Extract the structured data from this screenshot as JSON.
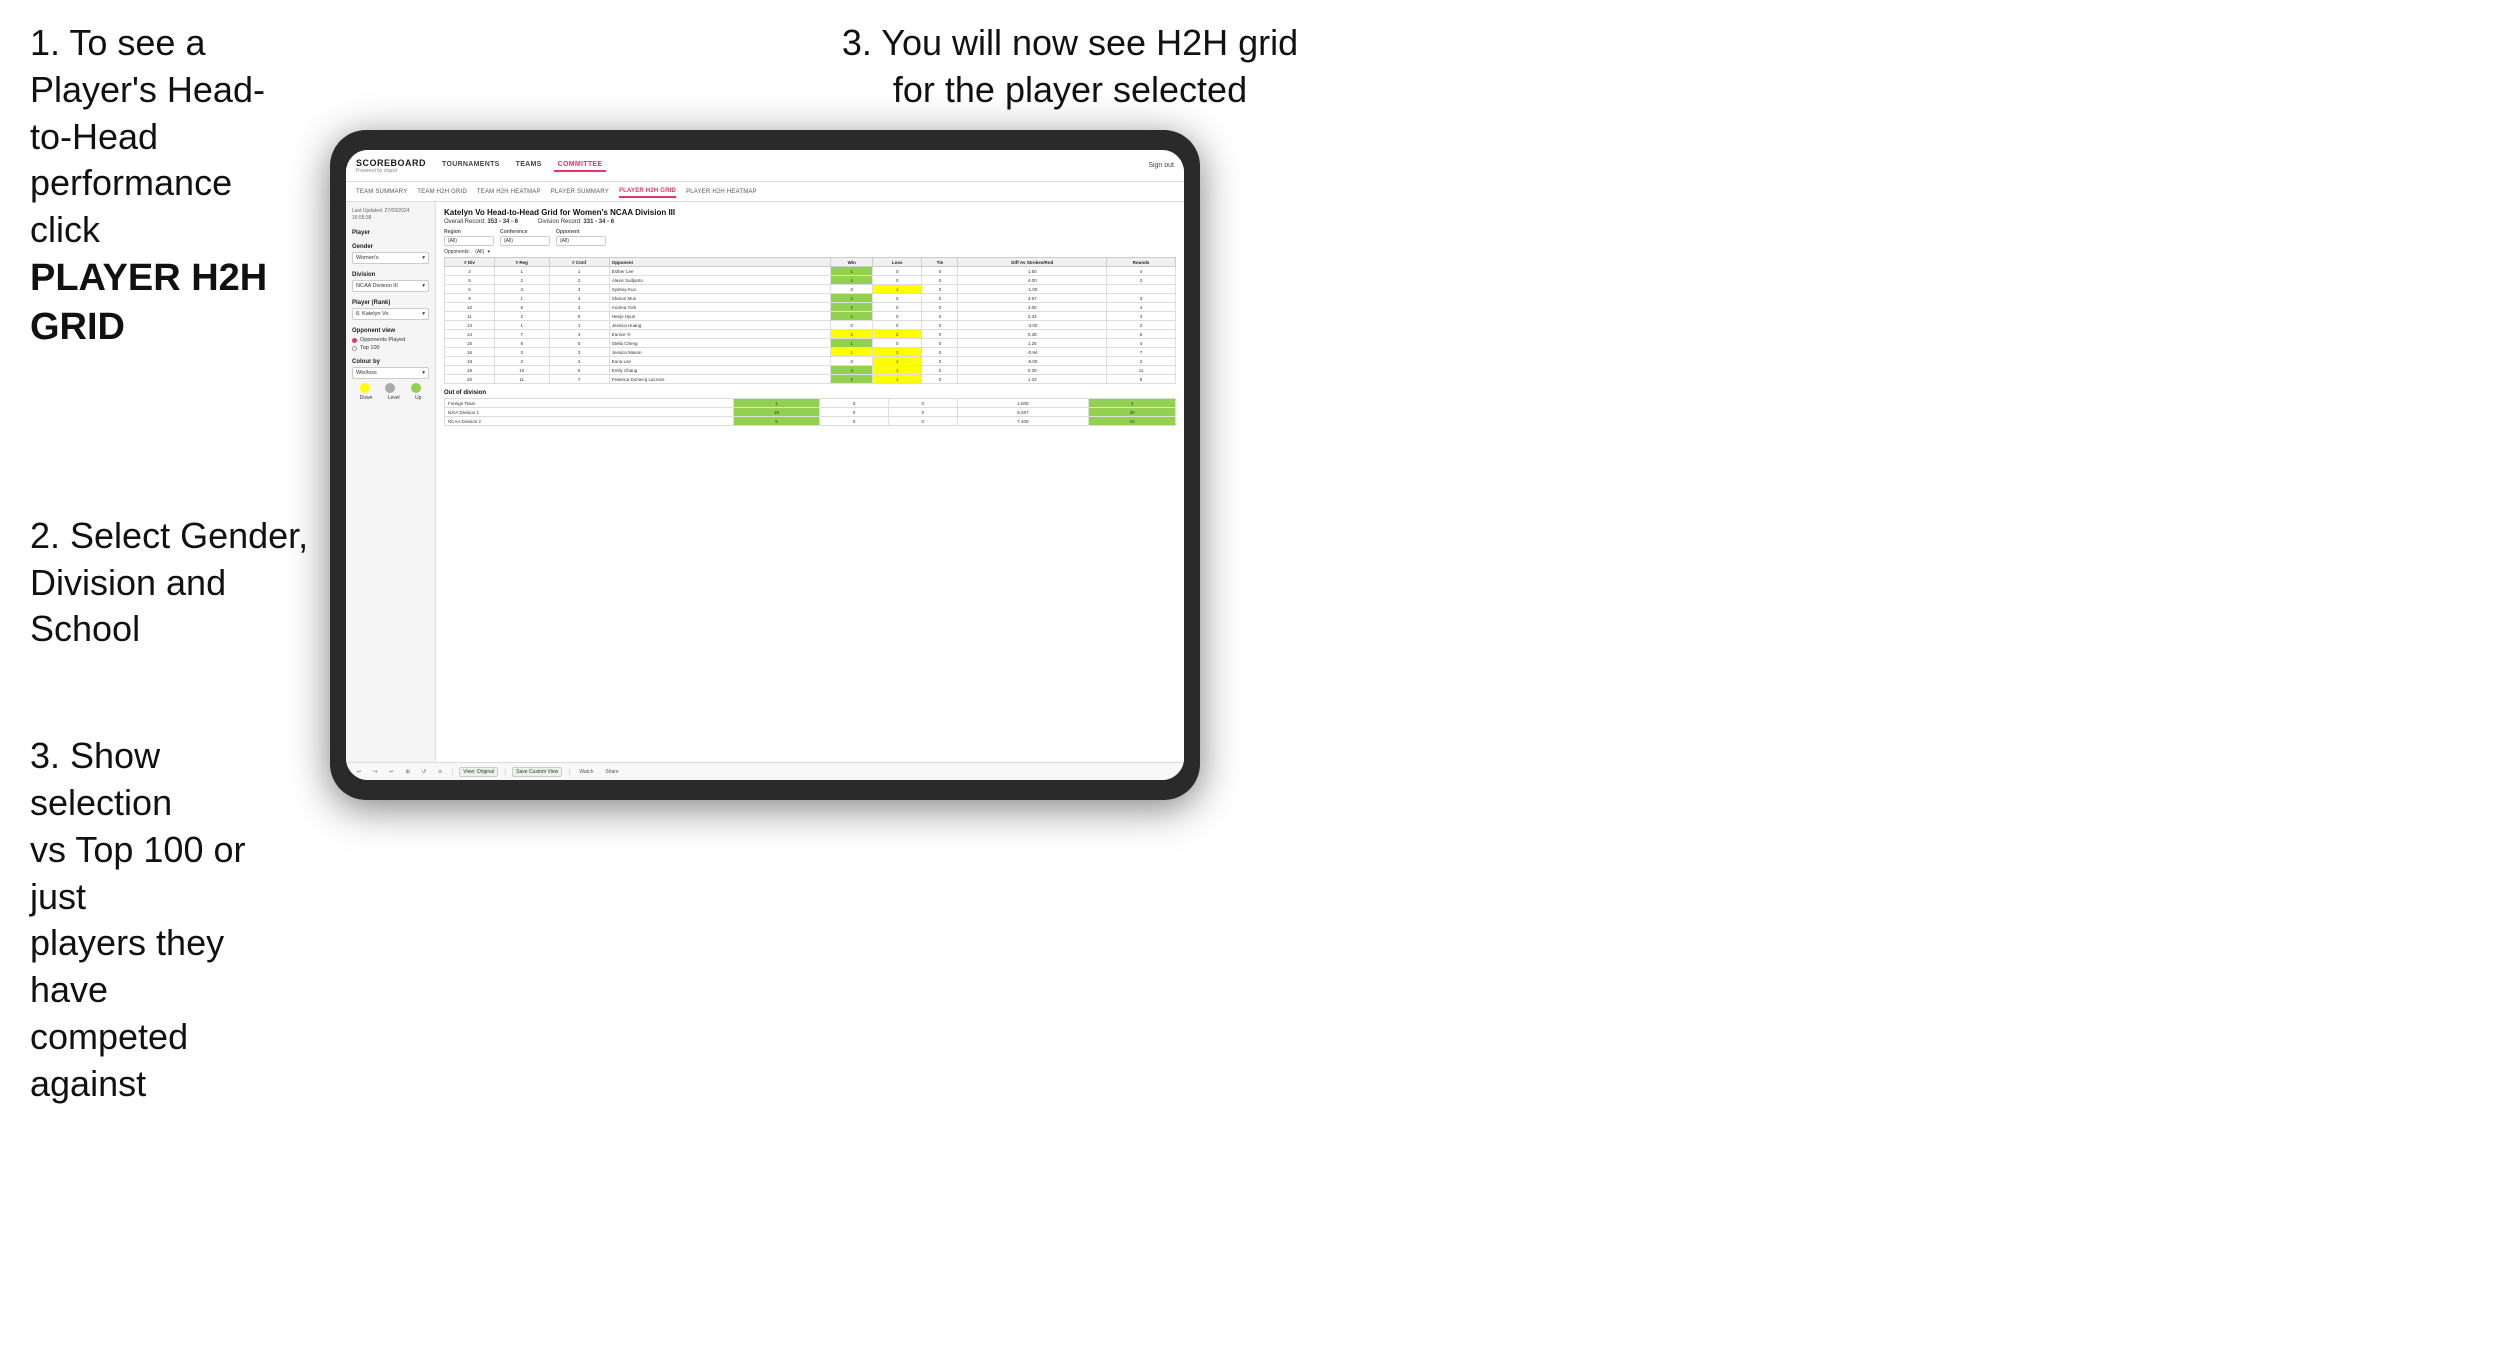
{
  "instructions": {
    "step1_line1": "1. To see a Player's Head-",
    "step1_line2": "to-Head performance click",
    "step1_bold": "PLAYER H2H GRID",
    "step2_line1": "2. Select Gender,",
    "step2_line2": "Division and",
    "step2_line3": "School",
    "step3a_line1": "3. You will now see H2H grid",
    "step3a_line2": "for the player selected",
    "step3b_line1": "3. Show selection",
    "step3b_line2": "vs Top 100 or just",
    "step3b_line3": "players they have",
    "step3b_line4": "competed against"
  },
  "navbar": {
    "logo": "SCOREBOARD",
    "logo_sub": "Powered by clippd",
    "nav_items": [
      "TOURNAMENTS",
      "TEAMS",
      "COMMITTEE"
    ],
    "sign_out": "Sign out"
  },
  "sub_navbar": {
    "items": [
      "TEAM SUMMARY",
      "TEAM H2H GRID",
      "TEAM H2H HEATMAP",
      "PLAYER SUMMARY",
      "PLAYER H2H GRID",
      "PLAYER H2H HEATMAP"
    ]
  },
  "sidebar": {
    "last_updated_label": "Last Updated: 27/03/2024",
    "last_updated_time": "16:55:38",
    "player_label": "Player",
    "gender_label": "Gender",
    "gender_value": "Women's",
    "division_label": "Division",
    "division_value": "NCAA Division III",
    "player_rank_label": "Player (Rank)",
    "player_rank_value": "8. Katelyn Vo",
    "opponent_view_label": "Opponent view",
    "radio1": "Opponents Played",
    "radio2": "Top 100",
    "colour_by_label": "Colour by",
    "colour_by_value": "Win/loss",
    "legend_down": "Down",
    "legend_level": "Level",
    "legend_up": "Up"
  },
  "grid": {
    "title": "Katelyn Vo Head-to-Head Grid for Women's NCAA Division III",
    "overall_record_label": "Overall Record:",
    "overall_record_value": "353 - 34 - 6",
    "division_record_label": "Division Record:",
    "division_record_value": "331 - 34 - 6",
    "region_label": "Region",
    "conference_label": "Conference",
    "opponent_label": "Opponent",
    "opponents_label": "Opponents:",
    "filter_all": "(All)",
    "col_div": "# Div",
    "col_reg": "# Reg",
    "col_conf": "# Conf",
    "col_opponent": "Opponent",
    "col_win": "Win",
    "col_loss": "Loss",
    "col_tie": "Tie",
    "col_diff": "Diff Av Strokes/Rnd",
    "col_rounds": "Rounds",
    "rows": [
      {
        "div": 3,
        "reg": 1,
        "conf": 1,
        "opponent": "Esther Lee",
        "win": 1,
        "loss": 0,
        "tie": 0,
        "diff": 1.5,
        "rounds": 4,
        "win_color": "green",
        "loss_color": "white",
        "tie_color": "white"
      },
      {
        "div": 5,
        "reg": 2,
        "conf": 2,
        "opponent": "Alexis Sudjanto",
        "win": 1,
        "loss": 0,
        "tie": 0,
        "diff": 4.0,
        "rounds": 3,
        "win_color": "green",
        "loss_color": "white",
        "tie_color": "white"
      },
      {
        "div": 6,
        "reg": 3,
        "conf": 3,
        "opponent": "Sydney Kuo",
        "win": 0,
        "loss": 1,
        "tie": 0,
        "diff": -1.0,
        "rounds": "",
        "win_color": "white",
        "loss_color": "yellow",
        "tie_color": "white"
      },
      {
        "div": 9,
        "reg": 1,
        "conf": 4,
        "opponent": "Sharon Mun",
        "win": 1,
        "loss": 0,
        "tie": 0,
        "diff": 3.67,
        "rounds": 3,
        "win_color": "green",
        "loss_color": "white",
        "tie_color": "white"
      },
      {
        "div": 10,
        "reg": 6,
        "conf": 3,
        "opponent": "Andrea York",
        "win": 2,
        "loss": 0,
        "tie": 0,
        "diff": 4.0,
        "rounds": 4,
        "win_color": "green",
        "loss_color": "white",
        "tie_color": "white"
      },
      {
        "div": 11,
        "reg": 2,
        "conf": 5,
        "opponent": "Heejo Hyun",
        "win": 1,
        "loss": 0,
        "tie": 0,
        "diff": 3.33,
        "rounds": 3,
        "win_color": "green",
        "loss_color": "white",
        "tie_color": "white"
      },
      {
        "div": 13,
        "reg": 1,
        "conf": 1,
        "opponent": "Jessica Huang",
        "win": 0,
        "loss": 0,
        "tie": 0,
        "diff": -3.0,
        "rounds": 2,
        "win_color": "white",
        "loss_color": "white",
        "tie_color": "white"
      },
      {
        "div": 14,
        "reg": 7,
        "conf": 4,
        "opponent": "Eunice Yi",
        "win": 2,
        "loss": 2,
        "tie": 0,
        "diff": 0.38,
        "rounds": 9,
        "win_color": "yellow",
        "loss_color": "yellow",
        "tie_color": "white"
      },
      {
        "div": 15,
        "reg": 8,
        "conf": 5,
        "opponent": "Stella Cheng",
        "win": 1,
        "loss": 0,
        "tie": 0,
        "diff": 1.25,
        "rounds": 4,
        "win_color": "green",
        "loss_color": "white",
        "tie_color": "white"
      },
      {
        "div": 16,
        "reg": 3,
        "conf": 3,
        "opponent": "Jessica Mason",
        "win": 1,
        "loss": 2,
        "tie": 0,
        "diff": -0.94,
        "rounds": 7,
        "win_color": "yellow",
        "loss_color": "yellow",
        "tie_color": "white"
      },
      {
        "div": 18,
        "reg": 2,
        "conf": 2,
        "opponent": "Euna Lee",
        "win": 0,
        "loss": 1,
        "tie": 0,
        "diff": -5.0,
        "rounds": 2,
        "win_color": "white",
        "loss_color": "yellow",
        "tie_color": "white"
      },
      {
        "div": 19,
        "reg": 10,
        "conf": 6,
        "opponent": "Emily Chang",
        "win": 4,
        "loss": 1,
        "tie": 0,
        "diff": 0.3,
        "rounds": 11,
        "win_color": "green",
        "loss_color": "yellow",
        "tie_color": "white"
      },
      {
        "div": 20,
        "reg": 11,
        "conf": 7,
        "opponent": "Federica Domecq Lacroze",
        "win": 2,
        "loss": 1,
        "tie": 0,
        "diff": 1.33,
        "rounds": 6,
        "win_color": "green",
        "loss_color": "yellow",
        "tie_color": "white"
      }
    ],
    "out_of_division_title": "Out of division",
    "out_rows": [
      {
        "name": "Foreign Team",
        "win": 1,
        "loss": 0,
        "tie": 0,
        "diff": 4.5,
        "rounds": 2,
        "color": "green"
      },
      {
        "name": "NAIA Division 1",
        "win": 15,
        "loss": 0,
        "tie": 0,
        "diff": 9.267,
        "rounds": 30,
        "color": "green"
      },
      {
        "name": "NCAA Division 2",
        "win": 5,
        "loss": 0,
        "tie": 0,
        "diff": 7.4,
        "rounds": 10,
        "color": "green"
      }
    ]
  },
  "toolbar": {
    "view_original": "View: Original",
    "save_custom": "Save Custom View",
    "watch": "Watch",
    "share": "Share"
  }
}
